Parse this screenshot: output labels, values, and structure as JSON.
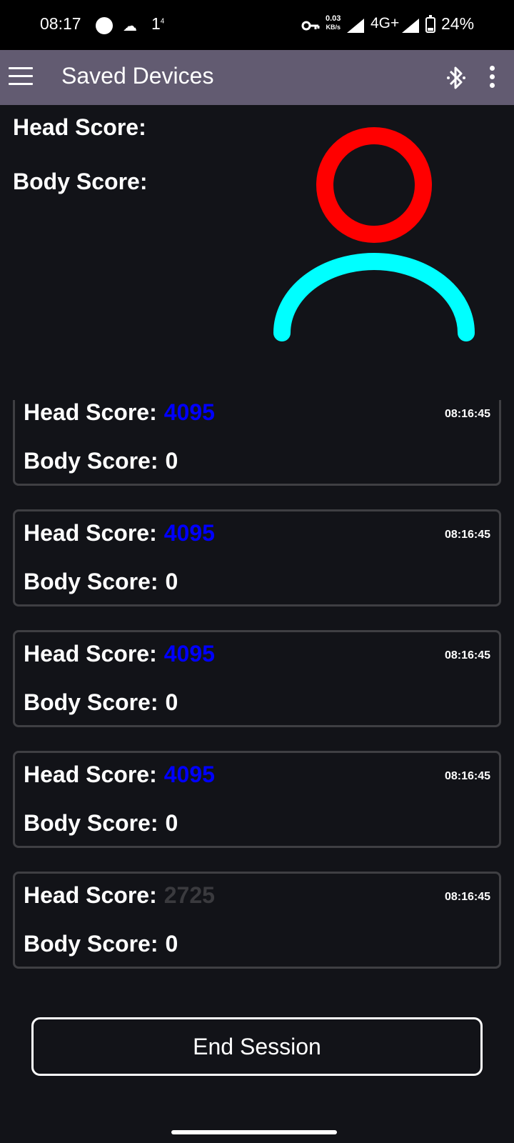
{
  "status_bar": {
    "time": "08:17",
    "notification_count": "1",
    "notification_sup": "4",
    "net_speed_value": "0.03",
    "net_speed_unit": "KB/s",
    "network": "4G+",
    "battery": "24%",
    "battery_level": 0.24
  },
  "app_bar": {
    "title": "Saved Devices"
  },
  "header": {
    "head_label": "Head Score:",
    "body_label": "Body Score:"
  },
  "avatar": {
    "head_color": "#ff0000",
    "body_color": "#00ffff"
  },
  "readings": [
    {
      "head_label": "Head Score:",
      "head_value": "4095",
      "head_color": "#0000ff",
      "body_label": "Body Score:",
      "body_value": "0",
      "time": "08:16:45"
    },
    {
      "head_label": "Head Score:",
      "head_value": "4095",
      "head_color": "#0000ff",
      "body_label": "Body Score:",
      "body_value": "0",
      "time": "08:16:45"
    },
    {
      "head_label": "Head Score:",
      "head_value": "4095",
      "head_color": "#0000ff",
      "body_label": "Body Score:",
      "body_value": "0",
      "time": "08:16:45"
    },
    {
      "head_label": "Head Score:",
      "head_value": "4095",
      "head_color": "#0000ff",
      "body_label": "Body Score:",
      "body_value": "0",
      "time": "08:16:45"
    },
    {
      "head_label": "Head Score:",
      "head_value": "2725",
      "head_color": "#3a3a3e",
      "body_label": "Body Score:",
      "body_value": "0",
      "time": "08:16:45"
    }
  ],
  "end_button_label": "End Session",
  "icons": {
    "menu": "menu-icon",
    "bluetooth": "bluetooth-icon",
    "more": "more-vert-icon",
    "key": "vpn-key-icon",
    "weather": "cloud-icon"
  }
}
